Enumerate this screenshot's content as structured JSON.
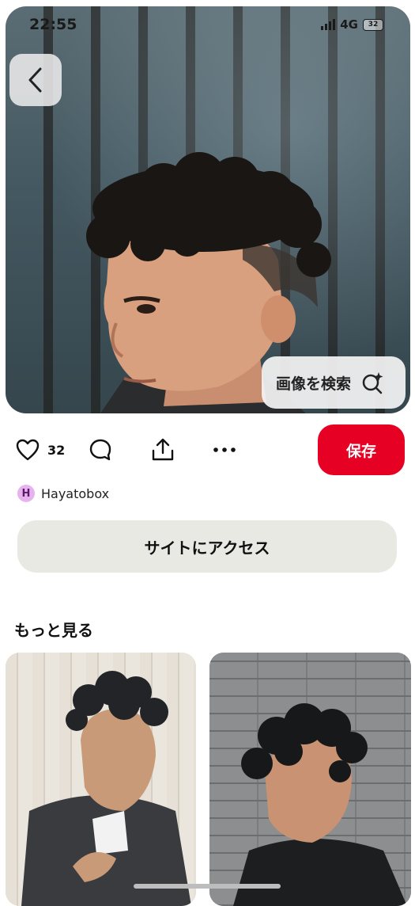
{
  "status_bar": {
    "time": "22:55",
    "network": "4G",
    "battery": "32"
  },
  "hero": {
    "search_label": "画像を検索"
  },
  "actions": {
    "like_count": "32",
    "save_label": "保存"
  },
  "author": {
    "initial": "H",
    "name": "Hayatobox"
  },
  "visit_button": "サイトにアクセス",
  "more_section": {
    "title": "もっと見る"
  },
  "colors": {
    "accent": "#e60023",
    "visit_bg": "#e9e9e4",
    "avatar_bg": "#e7b3ef"
  }
}
